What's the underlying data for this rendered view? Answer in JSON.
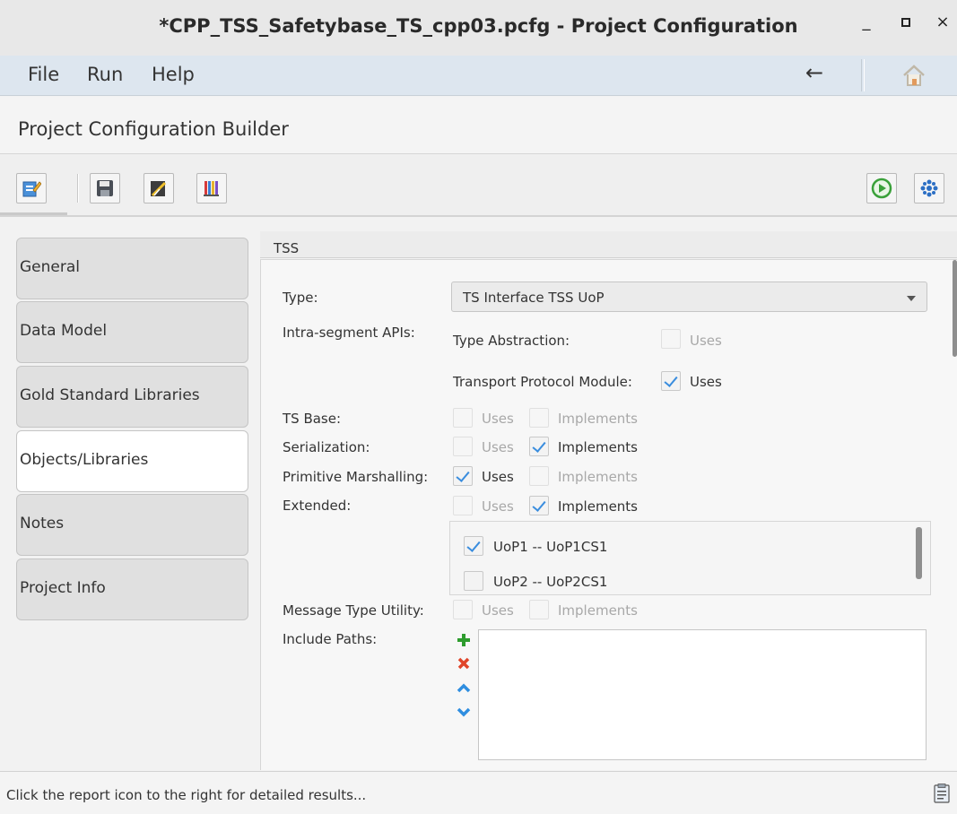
{
  "window": {
    "title": "*CPP_TSS_Safetybase_TS_cpp03.pcfg - Project Configuration",
    "minimize": "_",
    "maximize": "▫",
    "close": "×"
  },
  "menubar": {
    "items": [
      "File",
      "Run",
      "Help"
    ],
    "back": "←"
  },
  "builder_title": "Project Configuration Builder",
  "nav": {
    "tabs": [
      "General",
      "Data Model",
      "Gold Standard Libraries",
      "Objects/Libraries",
      "Notes",
      "Project Info"
    ],
    "active": "Objects/Libraries"
  },
  "panel": {
    "section_title": "TSS",
    "type_label": "Type:",
    "type_value": "TS Interface TSS UoP",
    "intra_label": "Intra-segment APIs:",
    "type_abstraction_label": "Type Abstraction:",
    "type_abstraction_uses": "Uses",
    "transport_label": "Transport Protocol Module:",
    "transport_uses": "Uses",
    "ts_base_label": "TS Base:",
    "serialization_label": "Serialization:",
    "primitive_label": "Primitive Marshalling:",
    "extended_label": "Extended:",
    "message_label": "Message Type Utility:",
    "include_label": "Include Paths:",
    "uses": "Uses",
    "implements": "Implements",
    "uop_list": [
      "UoP1 -- UoP1CS1",
      "UoP2 -- UoP2CS1"
    ]
  },
  "states": {
    "type_abstraction_uses": false,
    "transport_uses": true,
    "ts_base_uses": false,
    "ts_base_implements": false,
    "serialization_uses": false,
    "serialization_implements": true,
    "primitive_uses": true,
    "primitive_implements": false,
    "extended_uses": false,
    "extended_implements": true,
    "uop1": true,
    "uop2": false,
    "message_uses": false,
    "message_implements": false
  },
  "status_message": "Click the report icon to the right for detailed results...",
  "icons": {
    "toolbar": [
      "edit-config-icon",
      "save-icon",
      "generate-icon",
      "library-icon",
      "run-icon",
      "settings-icon"
    ],
    "include_paths": [
      "add-icon",
      "remove-icon",
      "move-up-icon",
      "move-down-icon"
    ],
    "colors": {
      "run": "#3aa13a",
      "add": "#2e9c2e",
      "remove": "#e0452a",
      "arrows": "#2f8ee0",
      "check": "#3a8dde"
    }
  }
}
